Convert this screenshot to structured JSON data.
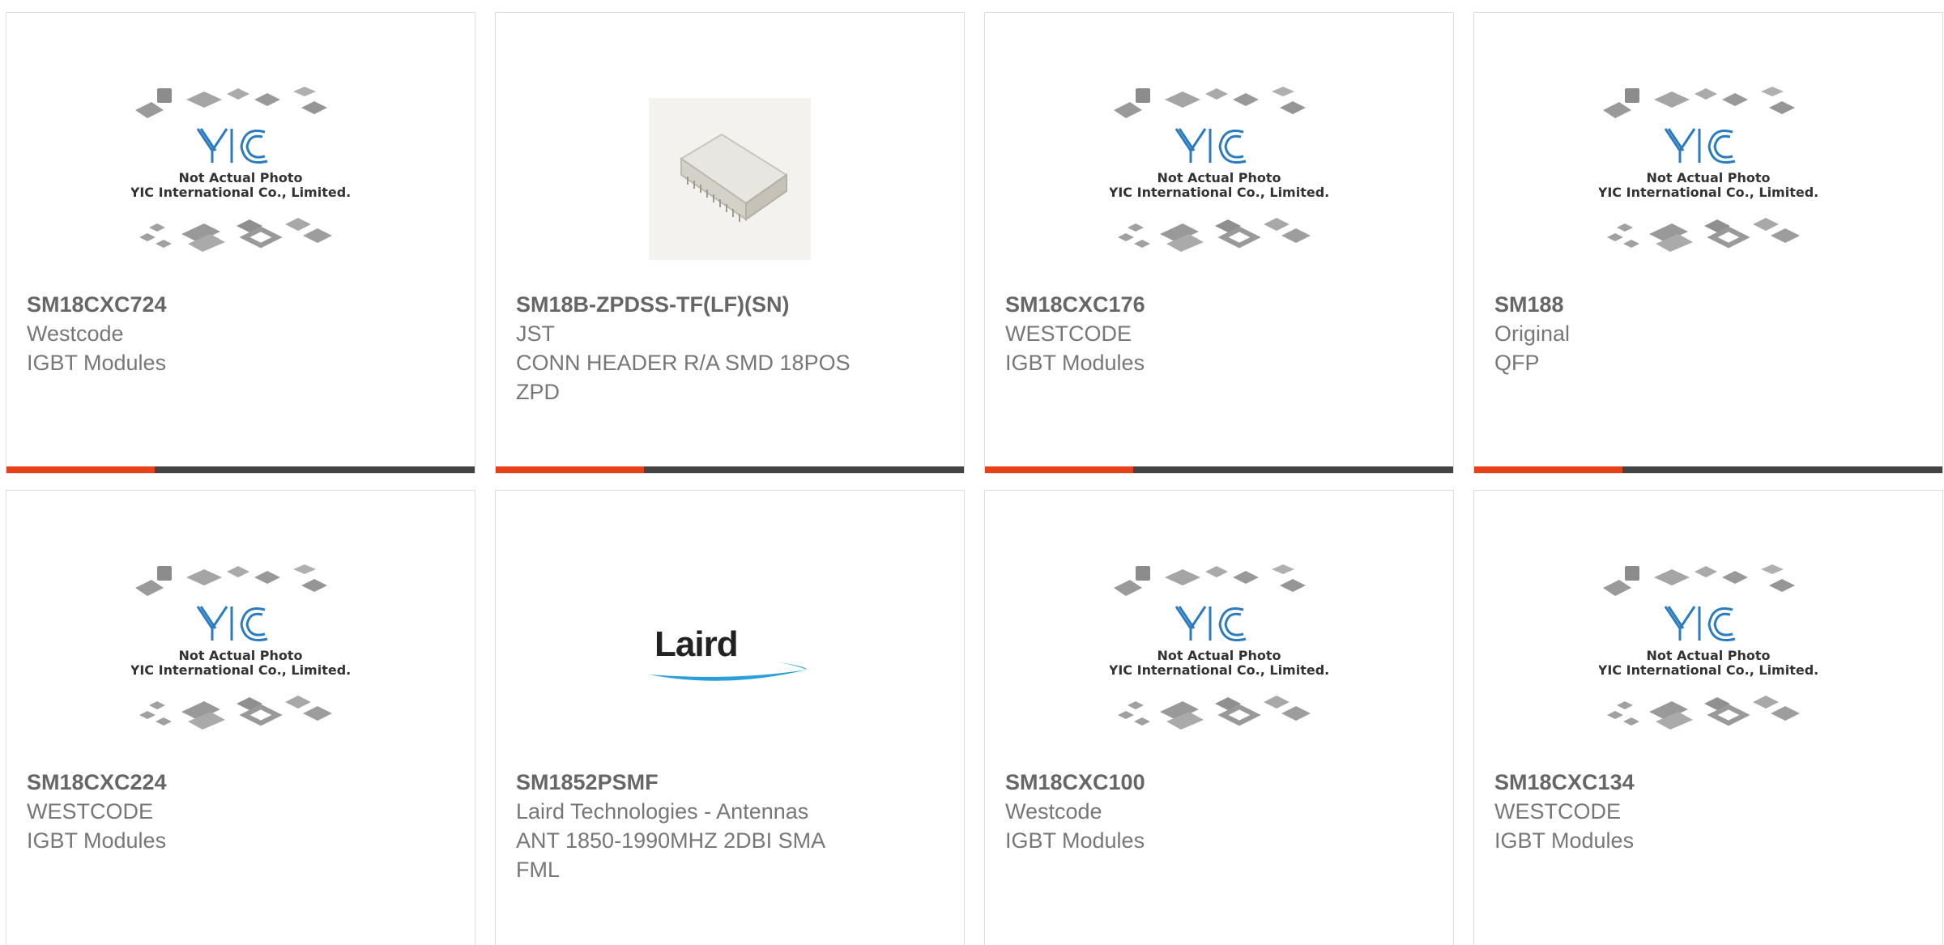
{
  "placeholder": {
    "logo_text": "YIC",
    "line1": "Not Actual Photo",
    "line2": "YIC International Co., Limited."
  },
  "brand_logo": {
    "laird": "Laird"
  },
  "accent_colors": {
    "accent": "#e8411a",
    "bar": "#444444"
  },
  "products": [
    {
      "part": "SM18CXC724",
      "manufacturer": "Westcode",
      "description": "IGBT Modules",
      "image": "placeholder"
    },
    {
      "part": "SM18B-ZPDSS-TF(LF)(SN)",
      "manufacturer": "JST",
      "description": "CONN HEADER R/A SMD 18POS ZPD",
      "image": "connector-photo"
    },
    {
      "part": "SM18CXC176",
      "manufacturer": "WESTCODE",
      "description": "IGBT Modules",
      "image": "placeholder"
    },
    {
      "part": "SM188",
      "manufacturer": "Original",
      "description": "QFP",
      "image": "placeholder"
    },
    {
      "part": "SM18CXC224",
      "manufacturer": "WESTCODE",
      "description": "IGBT Modules",
      "image": "placeholder"
    },
    {
      "part": "SM1852PSMF",
      "manufacturer": "Laird Technologies - Antennas",
      "description": "ANT 1850-1990MHZ 2DBI SMA FML",
      "image": "laird-logo"
    },
    {
      "part": "SM18CXC100",
      "manufacturer": "Westcode",
      "description": "IGBT Modules",
      "image": "placeholder"
    },
    {
      "part": "SM18CXC134",
      "manufacturer": "WESTCODE",
      "description": "IGBT Modules",
      "image": "placeholder"
    }
  ]
}
